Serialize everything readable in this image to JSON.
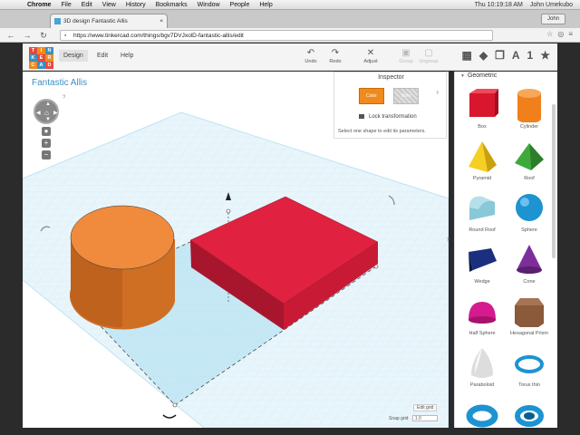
{
  "menubar": {
    "items": [
      "Chrome",
      "File",
      "Edit",
      "View",
      "History",
      "Bookmarks",
      "Window",
      "People",
      "Help"
    ],
    "clock": "Thu 10:19:18 AM",
    "user": "John Umekubo"
  },
  "browser": {
    "tab_title": "3D design Fantastic Allis",
    "profile": "John",
    "url": "https://www.tinkercad.com/things/bgv7DVJxolD-fantastic-allis/edit"
  },
  "app": {
    "logo_letters": [
      "T",
      "I",
      "N",
      "K",
      "E",
      "R",
      "C",
      "A",
      "D"
    ],
    "logo_colors": [
      "#e8483b",
      "#f08a1c",
      "#3a8fc7",
      "#3a8fc7",
      "#e8483b",
      "#f08a1c",
      "#f08a1c",
      "#3a8fc7",
      "#e8483b"
    ],
    "nav": {
      "design": "Design",
      "edit": "Edit",
      "help": "Help"
    },
    "tools": {
      "undo": "Undo",
      "redo": "Redo",
      "adjust": "Adjust",
      "group": "Group",
      "ungroup": "Ungroup"
    },
    "view_icons": {
      "text": "A",
      "number": "1",
      "star": "★"
    },
    "design_title": "Fantastic Allis",
    "help_mark": "?"
  },
  "inspector": {
    "title": "Inspector",
    "color_label": "Color",
    "hole_label": "Hole",
    "lock_label": "Lock transformation",
    "hint": "Select one shape to edit its parameters."
  },
  "workplane": {
    "edit_grid": "Edit grid",
    "snap_label": "Snap grid",
    "snap_value": "1.0",
    "cylinder_color": "#f08a3c",
    "box_color": "#e0213f",
    "grid_color": "#bfe3f3"
  },
  "shapes_panel": {
    "category": "Geometric",
    "items": [
      {
        "label": "Box",
        "color": "#d8172f"
      },
      {
        "label": "Cylinder",
        "color": "#f07f1c"
      },
      {
        "label": "Pyramid",
        "color": "#f5d022"
      },
      {
        "label": "Roof",
        "color": "#3daa3a"
      },
      {
        "label": "Round Roof",
        "color": "#89c8d8"
      },
      {
        "label": "Sphere",
        "color": "#1d93d2"
      },
      {
        "label": "Wedge",
        "color": "#1b2f7f"
      },
      {
        "label": "Cone",
        "color": "#7d2e9a"
      },
      {
        "label": "Half Sphere",
        "color": "#d61a8f"
      },
      {
        "label": "Hexagonal Prism",
        "color": "#8a5a3a"
      },
      {
        "label": "Paraboloid",
        "color": "#dddddd"
      },
      {
        "label": "Torus thin",
        "color": "#1d93d2"
      },
      {
        "label": "Torus",
        "color": "#1d93d2"
      },
      {
        "label": "Tube",
        "color": "#1d93d2"
      }
    ]
  }
}
